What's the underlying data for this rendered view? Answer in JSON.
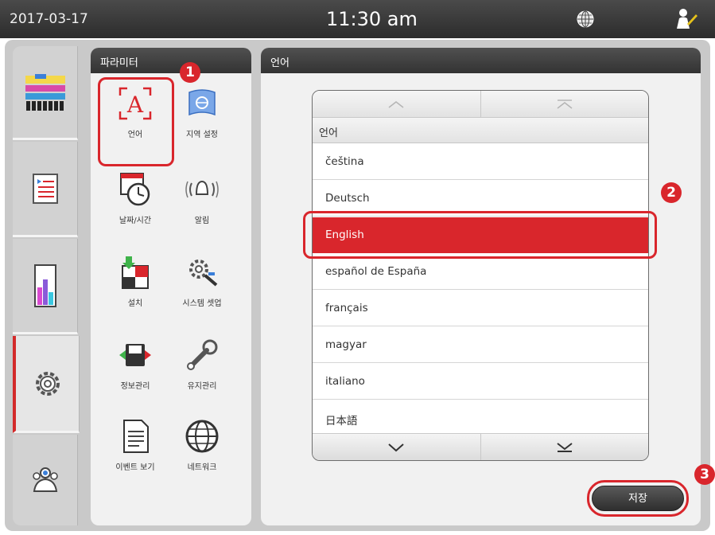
{
  "status_bar": {
    "date": "2017-03-17",
    "time": "11:30 am",
    "globe_icon": "globe-icon",
    "user_icon": "user-icon"
  },
  "sidebar": {
    "items": [
      {
        "icon": "reagent-station-icon"
      },
      {
        "icon": "program-list-icon"
      },
      {
        "icon": "reagent-status-icon"
      },
      {
        "icon": "settings-gear-icon",
        "active": true
      },
      {
        "icon": "user-management-icon"
      }
    ]
  },
  "param_panel": {
    "title": "파라미터",
    "items": [
      {
        "label": "언어",
        "icon": "language-icon"
      },
      {
        "label": "지역 설정",
        "icon": "region-settings-icon"
      },
      {
        "label": "날짜/시간",
        "icon": "date-time-icon"
      },
      {
        "label": "알림",
        "icon": "alarm-icon"
      },
      {
        "label": "설치",
        "icon": "installation-icon"
      },
      {
        "label": "시스템 셋업",
        "icon": "system-setup-icon"
      },
      {
        "label": "정보관리",
        "icon": "data-management-icon"
      },
      {
        "label": "유지관리",
        "icon": "maintenance-icon"
      },
      {
        "label": "이벤트 보기",
        "icon": "event-viewer-icon"
      },
      {
        "label": "네트워크",
        "icon": "network-icon"
      }
    ]
  },
  "language_panel": {
    "title": "언어",
    "list_header": "언어",
    "languages": [
      "čeština",
      "Deutsch",
      "English",
      "español de España",
      "français",
      "magyar",
      "italiano",
      "日本語"
    ],
    "selected": "English",
    "save_label": "저장"
  },
  "callouts": [
    "1",
    "2",
    "3"
  ],
  "colors": {
    "accent_red": "#d9262c",
    "header_dark": "#333333",
    "panel_bg": "#f1f1f1",
    "frame_bg": "#c9c9c9"
  }
}
